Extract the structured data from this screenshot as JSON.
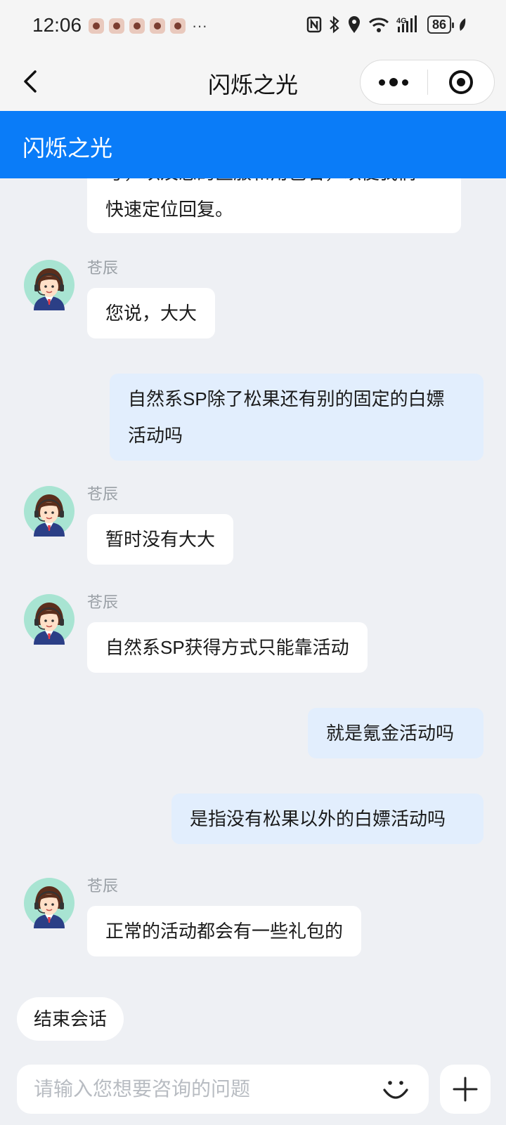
{
  "status_bar": {
    "time": "12:06",
    "more": "···",
    "icons": [
      "nfc-icon",
      "bluetooth-icon",
      "location-icon",
      "wifi-icon",
      "cellular-4g-icon",
      "battery-icon"
    ],
    "network": "4G",
    "battery": "86"
  },
  "nav": {
    "title": "闪烁之光"
  },
  "header": {
    "title": "闪烁之光"
  },
  "messages": [
    {
      "from": "agent",
      "text_line1": "号，以及您的区服和角色名，以便我们",
      "text_line2": "快速定位回复。"
    },
    {
      "from": "agent",
      "name": "苍辰",
      "text": "您说，大大"
    },
    {
      "from": "user",
      "text_line1": "自然系SP除了松果还有别的固定的白嫖",
      "text_line2": "活动吗"
    },
    {
      "from": "agent",
      "name": "苍辰",
      "text": "暂时没有大大"
    },
    {
      "from": "agent",
      "name": "苍辰",
      "text": "自然系SP获得方式只能靠活动"
    },
    {
      "from": "user",
      "text": "就是氪金活动吗"
    },
    {
      "from": "user",
      "text": "是指没有松果以外的白嫖活动吗"
    },
    {
      "from": "agent",
      "name": "苍辰",
      "text": "正常的活动都会有一些礼包的"
    }
  ],
  "end_session_label": "结束会话",
  "input": {
    "placeholder": "请输入您想要咨询的问题"
  },
  "colors": {
    "header_blue": "#0a7cf8",
    "user_bubble": "#e2eefd",
    "agent_bubble": "#ffffff",
    "background": "#eef0f4"
  }
}
